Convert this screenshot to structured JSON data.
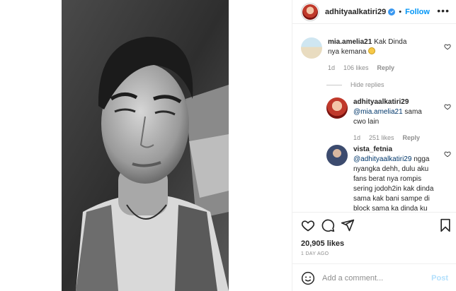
{
  "post": {
    "author": "adhityaalkatiri29",
    "follow_label": "Follow",
    "dot": "•",
    "more_label": "•••"
  },
  "comments": [
    {
      "user": "mia.amelia21",
      "text": "Kak Dinda nya kemana",
      "time": "1d",
      "likes": "106 likes",
      "reply": "Reply"
    }
  ],
  "hide_replies_label": "Hide replies",
  "replies": [
    {
      "user": "adhityaalkatiri29",
      "mention": "@mia.amelia21",
      "text": " sama cwo lain",
      "time": "1d",
      "likes": "251 likes",
      "reply": "Reply"
    },
    {
      "user": "vista_fetnia",
      "mention": "@adhityaalkatiri29",
      "text": " ngga nyangka dehh, dulu aku fans berat nya rompis sering jodoh2in kak dinda sama kak bani sampe di block sama ka dinda ku kira"
    }
  ],
  "stats": {
    "likes": "20,905 likes",
    "date": "1 DAY AGO"
  },
  "composer": {
    "placeholder": "Add a comment...",
    "post_label": "Post"
  },
  "icons": [
    "verified-icon",
    "emoji-icon",
    "heart-icon",
    "comment-icon",
    "share-icon",
    "bookmark-icon",
    "smiley-icon"
  ],
  "colors": {
    "accent": "#0095f6",
    "muted": "#8e8e8e",
    "text": "#262626",
    "border": "#efefef",
    "post_disabled": "#b2dffc"
  }
}
